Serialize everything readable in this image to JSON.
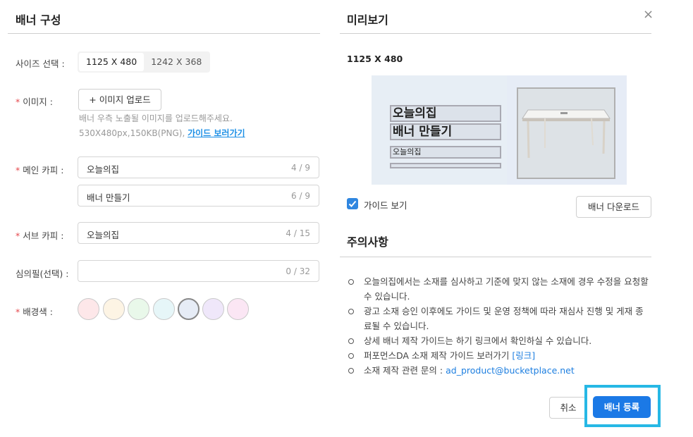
{
  "left": {
    "title": "배너 구성",
    "size_label": "사이즈 선택 :",
    "sizes": [
      "1125 X 480",
      "1242 X 368"
    ],
    "image_label": "이미지 :",
    "upload_button": "+ 이미지 업로드",
    "upload_hint_1": "배너 우측 노출될 이미지를 업로드해주세요.",
    "upload_hint_2": "530X480px,150KB(PNG),",
    "guide_link": "가이드 보러가기",
    "main_copy_label": "메인 카피 :",
    "main_copy_1": {
      "value": "오늘의집",
      "count": "4 / 9"
    },
    "main_copy_2": {
      "value": "배너 만들기",
      "count": "6 / 9"
    },
    "sub_copy_label": "서브 카피 :",
    "sub_copy": {
      "value": "오늘의집",
      "count": "4 / 15"
    },
    "review_label": "심의필(선택) :",
    "review": {
      "value": "",
      "count": "0 / 32"
    },
    "bg_label": "배경색 :",
    "bg_colors": [
      "#fde7e9",
      "#fdf4e4",
      "#e9f8ea",
      "#e6f6f8",
      "#e6ecf6",
      "#efe7fa",
      "#fbe6f4"
    ]
  },
  "right": {
    "title": "미리보기",
    "close": "×",
    "preview_size": "1125 X 480",
    "banner_main_1": "오늘의집",
    "banner_main_2": "배너 만들기",
    "banner_sub": "오늘의집",
    "guide_toggle": "가이드 보기",
    "download_button": "배너 다운로드",
    "notes_title": "주의사항",
    "notes": [
      "오늘의집에서는 소재를 심사하고 기준에 맞지 않는 소재에 경우 수정을 요청할 수 있습니다.",
      "광고 소재 승인 이후에도 가이드 및 운영 정책에 따라 재심사 진행 및 게재 종료될 수 있습니다.",
      "상세 배너 제작 가이드는 하기 링크에서 확인하실 수 있습니다.",
      "퍼포먼스DA 소재 제작 가이드 보러가기",
      "소재 제작 관련 문의 :"
    ],
    "note_link": "[링크]",
    "contact_email": "ad_product@bucketplace.net",
    "cancel_button": "취소",
    "submit_button": "배너 등록"
  },
  "colors": {
    "accent": "#1b79e6",
    "required": "#e5484d",
    "highlight": "#27b8e5"
  }
}
